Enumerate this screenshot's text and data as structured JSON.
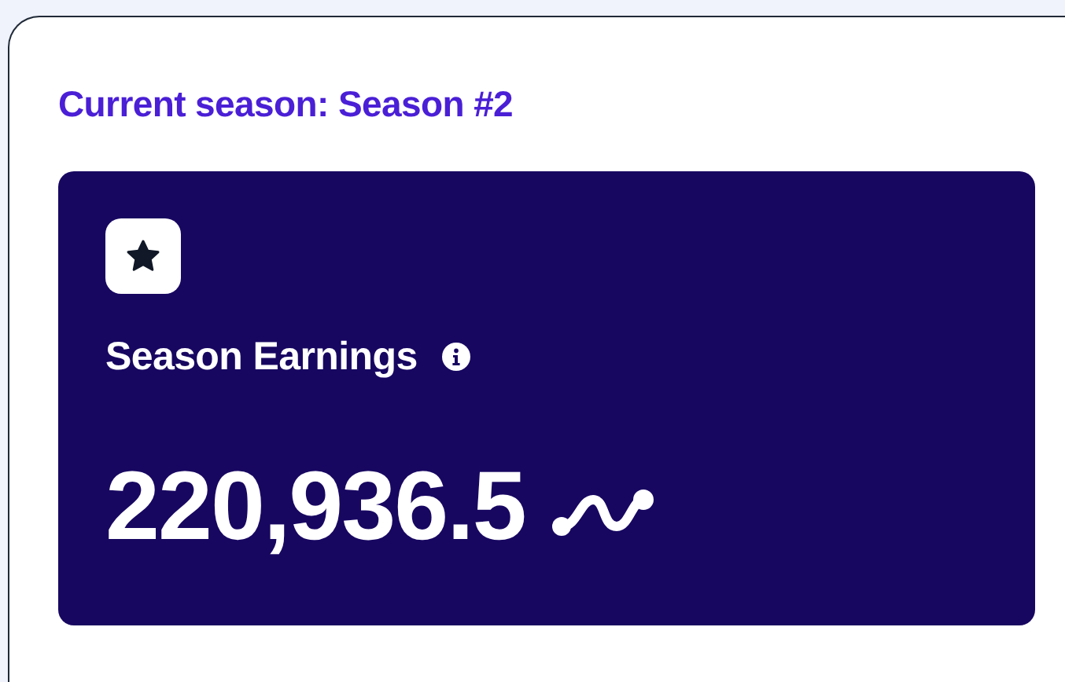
{
  "heading": "Current season: Season #2",
  "stat_card": {
    "title": "Season Earnings",
    "value": "220,936.5"
  }
}
